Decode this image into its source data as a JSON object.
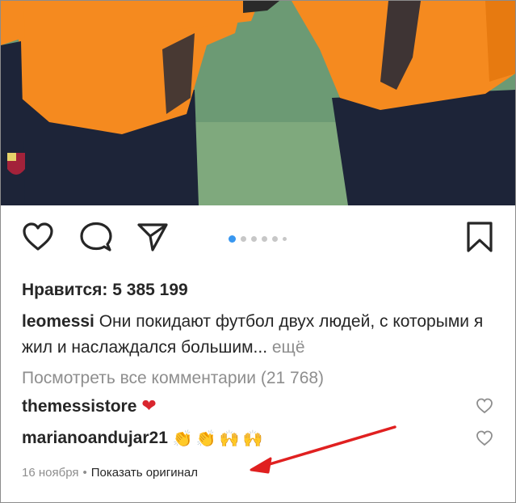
{
  "post": {
    "likes_label": "Нравится: 5 385 199",
    "caption": {
      "username": "leomessi",
      "text": " Они покидают футбол двух людей, с которыми я жил и наслаждался большим...",
      "more": " ещё"
    },
    "view_all_comments": "Посмотреть все комментарии (21 768)",
    "comments": [
      {
        "username": "themessistore",
        "emoji": "❤"
      },
      {
        "username": "marianoandujar21",
        "emoji": "👏👏🙌🙌"
      }
    ],
    "date": "16 ноября",
    "separator": "•",
    "translate_label": "Показать оригинал"
  },
  "carousel": {
    "count": 6,
    "active_index": 0
  },
  "icons": {
    "like": "heart-outline-icon",
    "comment": "speech-bubble-icon",
    "share": "paper-plane-icon",
    "save": "bookmark-icon"
  },
  "colors": {
    "accent_dot": "#3897f0",
    "arrow": "#e02020",
    "muted_text": "#8e8e8e",
    "jersey": "#f58a1f"
  }
}
